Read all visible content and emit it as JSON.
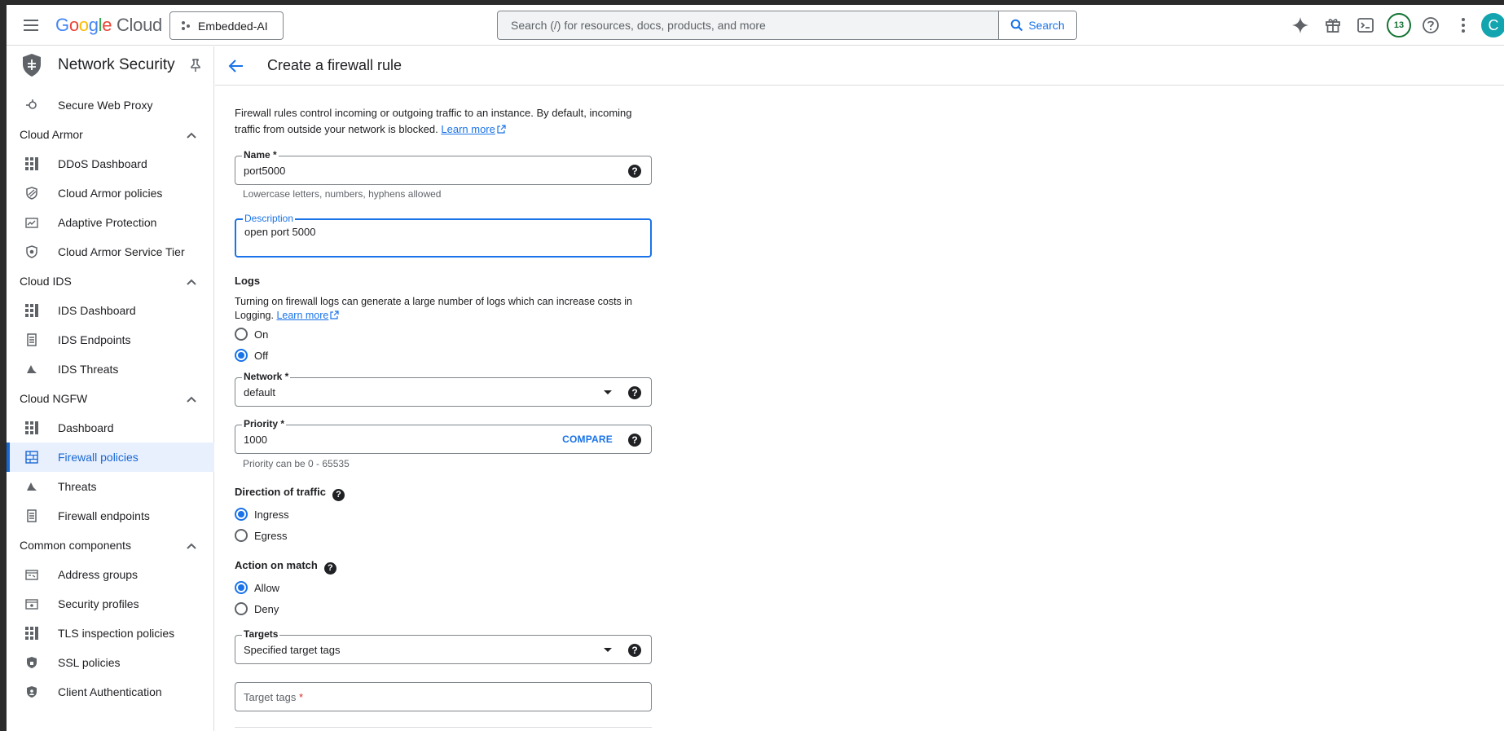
{
  "topbar": {
    "logo_google": "Google",
    "logo_cloud": "Cloud",
    "project": "Embedded-AI",
    "search_placeholder": "Search (/) for resources, docs, products, and more",
    "search_button": "Search",
    "notification_count": "13",
    "avatar_initial": "C"
  },
  "sidebar": {
    "title": "Network Security",
    "items": [
      {
        "type": "item",
        "label": "Secure Web Proxy",
        "icon": "proxy-icon"
      },
      {
        "type": "section",
        "label": "Cloud Armor"
      },
      {
        "type": "item",
        "label": "DDoS Dashboard",
        "icon": "dashboard-icon"
      },
      {
        "type": "item",
        "label": "Cloud Armor policies",
        "icon": "armor-shield-icon"
      },
      {
        "type": "item",
        "label": "Adaptive Protection",
        "icon": "adaptive-chart-icon"
      },
      {
        "type": "item",
        "label": "Cloud Armor Service Tier",
        "icon": "service-tier-shield-icon"
      },
      {
        "type": "section",
        "label": "Cloud IDS"
      },
      {
        "type": "item",
        "label": "IDS Dashboard",
        "icon": "dashboard-icon"
      },
      {
        "type": "item",
        "label": "IDS Endpoints",
        "icon": "endpoint-icon"
      },
      {
        "type": "item",
        "label": "IDS Threats",
        "icon": "threat-icon"
      },
      {
        "type": "section",
        "label": "Cloud NGFW"
      },
      {
        "type": "item",
        "label": "Dashboard",
        "icon": "dashboard-icon"
      },
      {
        "type": "item",
        "label": "Firewall policies",
        "icon": "firewall-grid-icon",
        "active": true
      },
      {
        "type": "item",
        "label": "Threats",
        "icon": "threat-icon"
      },
      {
        "type": "item",
        "label": "Firewall endpoints",
        "icon": "endpoint-icon"
      },
      {
        "type": "section",
        "label": "Common components"
      },
      {
        "type": "item",
        "label": "Address groups",
        "icon": "address-group-icon"
      },
      {
        "type": "item",
        "label": "Security profiles",
        "icon": "security-profile-icon"
      },
      {
        "type": "item",
        "label": "TLS inspection policies",
        "icon": "dashboard-icon"
      },
      {
        "type": "item",
        "label": "SSL policies",
        "icon": "ssl-shield-icon"
      },
      {
        "type": "item",
        "label": "Client Authentication",
        "icon": "client-auth-shield-icon"
      }
    ]
  },
  "page": {
    "title": "Create a firewall rule",
    "intro_text": "Firewall rules control incoming or outgoing traffic to an instance. By default, incoming traffic from outside your network is blocked.",
    "learn_more": "Learn more"
  },
  "form": {
    "name": {
      "label": "Name *",
      "value": "port5000",
      "hint": "Lowercase letters, numbers, hyphens allowed"
    },
    "description": {
      "label": "Description",
      "value": "open port 5000"
    },
    "logs": {
      "title": "Logs",
      "text": "Turning on firewall logs can generate a large number of logs which can increase costs in Logging.",
      "learn_more": "Learn more",
      "options": [
        "On",
        "Off"
      ],
      "selected": "Off"
    },
    "network": {
      "label": "Network *",
      "value": "default"
    },
    "priority": {
      "label": "Priority *",
      "value": "1000",
      "compare": "COMPARE",
      "hint": "Priority can be 0 - 65535"
    },
    "direction": {
      "title": "Direction of traffic",
      "options": [
        "Ingress",
        "Egress"
      ],
      "selected": "Ingress"
    },
    "action": {
      "title": "Action on match",
      "options": [
        "Allow",
        "Deny"
      ],
      "selected": "Allow"
    },
    "targets": {
      "label": "Targets",
      "value": "Specified target tags"
    },
    "target_tags": {
      "placeholder": "Target tags",
      "required_mark": "*"
    }
  },
  "colors": {
    "accent": "#1a73e8",
    "active_bg": "#e8f0fe",
    "avatar": "#12a4af",
    "badge": "#137333"
  }
}
